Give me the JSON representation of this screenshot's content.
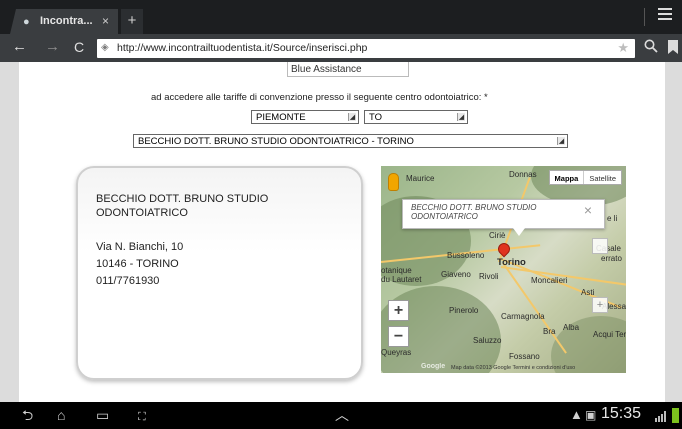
{
  "browser": {
    "tab": {
      "title": "Incontra...",
      "favicon": "browser-globe-icon",
      "close_glyph": "×"
    },
    "new_tab_glyph": "+",
    "url": "http://www.incontrailtuodentista.it/Source/inserisci.php",
    "icons": [
      "back-arrow-icon",
      "forward-arrow-icon",
      "reload-icon",
      "site-info-icon",
      "bookmark-star-icon",
      "search-icon",
      "bookmarks-icon",
      "menu-icon"
    ]
  },
  "form": {
    "assistance_value": "Blue Assistance",
    "access_text": "ad accedere alle tariffe di convenzione presso il seguente centro odontoiatrico: *",
    "region_value": "PIEMONTE",
    "province_value": "TO",
    "center_value": "BECCHIO DOTT. BRUNO STUDIO ODONTOIATRICO - TORINO"
  },
  "card": {
    "name": "BECCHIO DOTT. BRUNO STUDIO ODONTOIATRICO",
    "street": "Via N. Bianchi, 10",
    "city": "10146 - TORINO",
    "phone": "011/7761930"
  },
  "map": {
    "type_map": "Mappa",
    "type_satellite": "Satellite",
    "infowindow_text": "BECCHIO DOTT. BRUNO STUDIO ODONTOIATRICO",
    "infowindow_close": "×",
    "zoom_in": "+",
    "zoom_out": "−",
    "logo": "Google",
    "footer": "Map data ©2013 Google   Termini e condizioni d'uso",
    "places": {
      "maurice": "Maurice",
      "donnas": "Donnas",
      "ciri": "Ciriè",
      "bussoleno": "Bussoleno",
      "torino": "Torino",
      "giaveno": "Giaveno",
      "rivoli": "Rivoli",
      "moncalieri": "Moncalieri",
      "asti": "Asti",
      "alessandria": "Alessa",
      "pinerolo": "Pinerolo",
      "carmagnola": "Carmagnola",
      "bra": "Bra",
      "alba": "Alba",
      "acqui": "Acqui Term",
      "saluzzo": "Saluzzo",
      "fossano": "Fossano",
      "queyras": "Queyras",
      "casale": "Casale",
      "ferrato": "errato",
      "li": "e li",
      "botaniques": "otanique",
      "lautaret": "du Lautaret"
    }
  },
  "system": {
    "clock": "15:35",
    "icons": [
      "back-nav-icon",
      "home-icon",
      "recent-apps-icon",
      "screenshot-icon",
      "up-chevron-icon",
      "warning-icon",
      "image-notification-icon",
      "signal-icon",
      "battery-icon"
    ]
  },
  "colors": {
    "toolbar": "#3a3d40",
    "tabstrip": "#1c1e20",
    "marker": "#e0341f",
    "battery": "#7cc11e"
  }
}
